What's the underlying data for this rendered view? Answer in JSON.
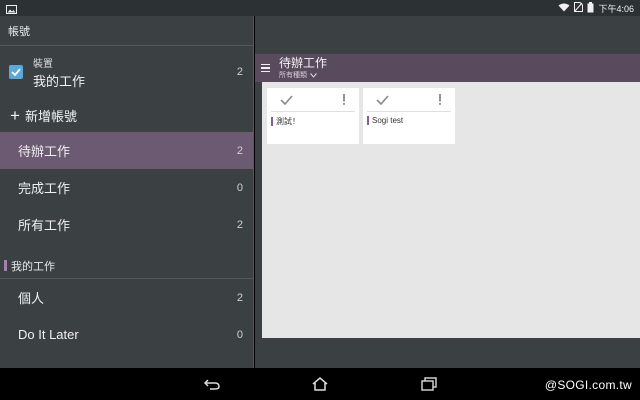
{
  "status_bar": {
    "time": "下午4:06",
    "icons": [
      "gallery-icon",
      "wifi-icon",
      "sim-off-icon",
      "battery-icon"
    ]
  },
  "drawer": {
    "accounts_header": "帳號",
    "account": {
      "sub_label": "裝置",
      "name": "我的工作",
      "count": "2",
      "checked": true
    },
    "add_account": "新增帳號",
    "filters": [
      {
        "label": "待辦工作",
        "count": "2",
        "active": true
      },
      {
        "label": "完成工作",
        "count": "0",
        "active": false
      },
      {
        "label": "所有工作",
        "count": "2",
        "active": false
      }
    ],
    "group_header": "我的工作",
    "group_items": [
      {
        "label": "個人",
        "count": "2"
      },
      {
        "label": "Do It Later",
        "count": "0"
      }
    ]
  },
  "main": {
    "title": "待辦工作",
    "filter_label": "所有種類",
    "cards": [
      {
        "text": "測試！"
      },
      {
        "text": "Sogi test"
      }
    ]
  },
  "watermark": "@SOGI.com.tw",
  "colors": {
    "drawer_bg": "#3b4143",
    "active_item": "#6c5a72",
    "list_bar": "#594a5e",
    "checkbox": "#5aa9d8",
    "category_marker": "#8a5b94"
  }
}
